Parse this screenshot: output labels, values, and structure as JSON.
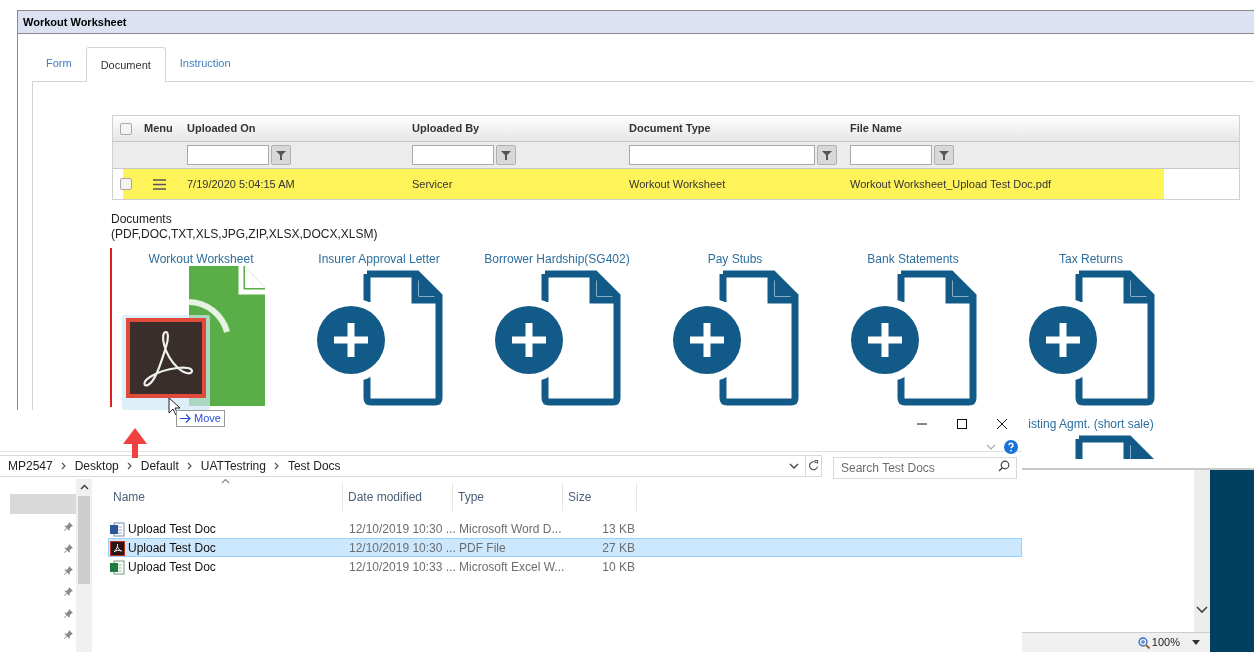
{
  "window": {
    "title": "Workout Worksheet"
  },
  "tabs": [
    {
      "label": "Form",
      "selected": false
    },
    {
      "label": "Document",
      "selected": true
    },
    {
      "label": "Instruction",
      "selected": false
    }
  ],
  "grid": {
    "header_checked": false,
    "menu_column": {
      "label": "Menu"
    },
    "columns": [
      {
        "label": "Uploaded On",
        "kind": "filter"
      },
      {
        "label": "Uploaded By",
        "kind": "filter"
      },
      {
        "label": "Document Type",
        "kind": "filter"
      },
      {
        "label": "File Name",
        "kind": "filter"
      }
    ],
    "rows": [
      {
        "checked": false,
        "selected": true,
        "cells": [
          "7/19/2020 5:04:15 AM",
          "Servicer",
          "Workout Worksheet",
          "Workout Worksheet_Upload Test Doc.pdf"
        ]
      }
    ]
  },
  "documents": {
    "label": "Documents",
    "formats": "(PDF,DOC,TXT,XLS,JPG,ZIP,XLSX,DOCX,XLSM)",
    "tiles": [
      {
        "label": "Workout Worksheet",
        "kind": "uploaded"
      },
      {
        "label": "Insurer Approval Letter",
        "kind": "empty"
      },
      {
        "label": "Borrower Hardship(SG402)",
        "kind": "empty"
      },
      {
        "label": "Pay Stubs",
        "kind": "empty"
      },
      {
        "label": "Bank Statements",
        "kind": "empty"
      },
      {
        "label": "Tax Returns",
        "kind": "empty"
      }
    ],
    "second_row_tile": {
      "label": "isting Agmt. (short sale)",
      "kind": "empty"
    }
  },
  "drag": {
    "tooltip": "Move"
  },
  "explorer": {
    "breadcrumb": [
      "MP2547",
      "Desktop",
      "Default",
      "UATTestring",
      "Test Docs"
    ],
    "search": {
      "placeholder": "Search Test Docs"
    },
    "columns": [
      "Name",
      "Date modified",
      "Type",
      "Size"
    ],
    "files": [
      {
        "name": "Upload Test Doc",
        "kind": "word",
        "modified": "12/10/2019 10:30 ...",
        "type": "Microsoft Word D...",
        "size": "13 KB",
        "selected": false
      },
      {
        "name": "Upload Test Doc",
        "kind": "pdf",
        "modified": "12/10/2019 10:30 ...",
        "type": "PDF File",
        "size": "27 KB",
        "selected": true
      },
      {
        "name": "Upload Test Doc",
        "kind": "excel",
        "modified": "12/10/2019 10:33 ...",
        "type": "Microsoft Excel W...",
        "size": "10 KB",
        "selected": false
      }
    ]
  },
  "viewer": {
    "zoom": "100%"
  }
}
